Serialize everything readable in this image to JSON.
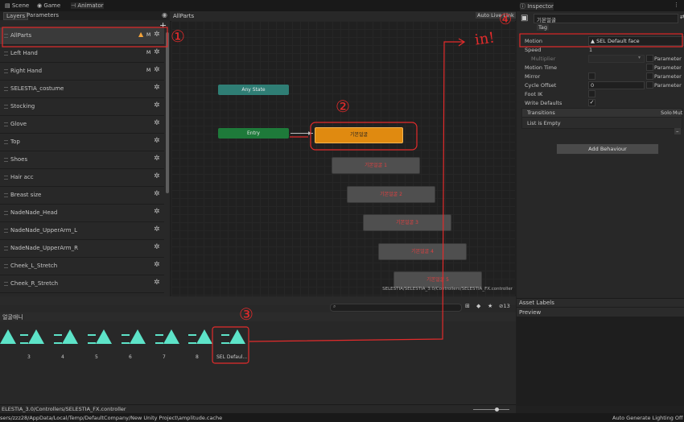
{
  "tabs": {
    "scene": "Scene",
    "game": "Game",
    "animator": "Animator",
    "inspector": "Inspector"
  },
  "layers_panel": {
    "tab_layers": "Layers",
    "tab_parameters": "Parameters",
    "items": [
      {
        "label": "AllParts",
        "badge": "M"
      },
      {
        "label": "Left Hand",
        "badge": "M"
      },
      {
        "label": "Right Hand",
        "badge": "M"
      },
      {
        "label": "SELESTIA_costume",
        "badge": ""
      },
      {
        "label": "Stocking",
        "badge": ""
      },
      {
        "label": "Glove",
        "badge": ""
      },
      {
        "label": "Top",
        "badge": ""
      },
      {
        "label": "Shoes",
        "badge": ""
      },
      {
        "label": "Hair acc",
        "badge": ""
      },
      {
        "label": "Breast size",
        "badge": ""
      },
      {
        "label": "NadeNade_Head",
        "badge": ""
      },
      {
        "label": "NadeNade_UpperArm_L",
        "badge": ""
      },
      {
        "label": "NadeNade_UpperArm_R",
        "badge": ""
      },
      {
        "label": "Cheek_L_Stretch",
        "badge": ""
      },
      {
        "label": "Cheek_R_Stretch",
        "badge": ""
      }
    ]
  },
  "graph": {
    "breadcrumb": "AllParts",
    "auto_live_link": "Auto Live Link",
    "any_state": "Any State",
    "entry": "Entry",
    "default_state": "기본얼굴",
    "states": [
      "기본얼굴 1",
      "기본얼굴 2",
      "기본얼굴 3",
      "기본얼굴 4",
      "기본얼굴 5"
    ],
    "path": "SELESTIA/SELESTIA_3.0/Controllers/SELESTIA_FX.controller"
  },
  "inspector": {
    "title": "기본얼굴",
    "tag": "Tag",
    "motion_label": "Motion",
    "motion_value": "SEL Default face",
    "speed_label": "Speed",
    "speed_value": "1",
    "multiplier": "Multiplier",
    "motion_time": "Motion Time",
    "mirror": "Mirror",
    "cycle_offset": "Cycle Offset",
    "cycle_offset_value": "0",
    "foot_ik": "Foot IK",
    "write_defaults": "Write Defaults",
    "parameter": "Parameter",
    "transitions": "Transitions",
    "solo": "Solo",
    "mute": "Mut",
    "list_empty": "List is Empty",
    "add_behaviour": "Add Behaviour",
    "asset_labels": "Asset Labels",
    "preview": "Preview"
  },
  "project": {
    "folder": "얼굴애니",
    "count": "13",
    "assets": [
      "3",
      "4",
      "5",
      "6",
      "7",
      "8",
      "SEL Defaul..."
    ],
    "footer_path": "ELESTIA_3.0/Controllers/SELESTIA_FX.controller"
  },
  "status": {
    "left": "sers/zzz28/AppData/Local/Temp/DefaultCompany/New Unity Project\\amplitude.cache",
    "right": "Auto Generate Lighting Off"
  },
  "annotations": {
    "n1": "①",
    "n2": "②",
    "n3": "③",
    "n4": "④",
    "in": "in!"
  }
}
